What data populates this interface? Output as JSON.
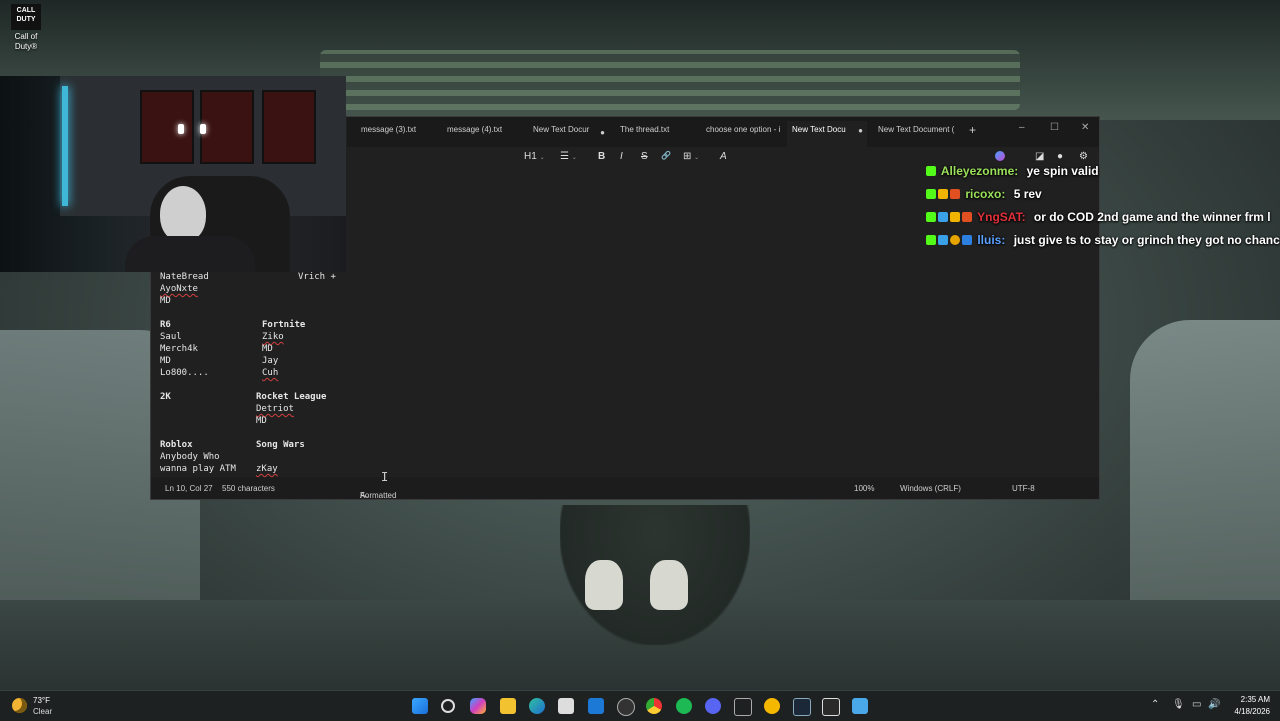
{
  "desktop": {
    "icon": {
      "badge_text": "CALL\nDUTY",
      "label": "Call of Duty®"
    }
  },
  "notepad": {
    "tabs": [
      {
        "label": "message (3).txt",
        "modified": false
      },
      {
        "label": "message (4).txt",
        "modified": false
      },
      {
        "label": "New Text Docur",
        "modified": true
      },
      {
        "label": "The thread.txt",
        "modified": false
      },
      {
        "label": "choose one option - i",
        "modified": false
      },
      {
        "label": "New Text Docu",
        "modified": true,
        "active": true
      },
      {
        "label": "New Text Document (",
        "modified": false
      }
    ],
    "new_tab_symbol": "+",
    "window_controls": {
      "minimize": "–",
      "maximize": "☐",
      "close": "✕"
    },
    "toolbar": {
      "heading": "H1",
      "chevron": "⌄",
      "list": "☰",
      "bold": "B",
      "italic": "I",
      "strike": "S",
      "link": "🔗",
      "table": "⊞",
      "clear": "A"
    },
    "lines": [
      {
        "left": "NateBread",
        "right": "Vrich +"
      },
      {
        "left": "AyoNxte",
        "right": ""
      },
      {
        "left": "MD",
        "right": ""
      },
      {
        "left": "",
        "right": ""
      },
      {
        "left": "R6",
        "right": "Fortnite"
      },
      {
        "left": "Saul",
        "right": "Ziko"
      },
      {
        "left": "Merch4k",
        "right": "MD"
      },
      {
        "left": "MD",
        "right": "Jay"
      },
      {
        "left": "Lo800....",
        "right": "Cuh"
      },
      {
        "left": "",
        "right": ""
      },
      {
        "left": "2K",
        "right": "Rocket League"
      },
      {
        "left": "",
        "right": "Detriot"
      },
      {
        "left": "",
        "right": "MD"
      },
      {
        "left": "",
        "right": ""
      },
      {
        "left": "Roblox",
        "right": "Song Wars"
      },
      {
        "left": "Anybody Who",
        "right": ""
      },
      {
        "left": "wanna play ATM",
        "right": "zKay"
      }
    ],
    "status": {
      "position": "Ln 10, Col 27",
      "characters": "550 characters",
      "mode": "Formatted",
      "zoom": "100%",
      "line_endings": "Windows (CRLF)",
      "encoding": "UTF-8"
    }
  },
  "chat": [
    {
      "user": "Alleyezonme:",
      "text": "ye spin valid",
      "user_color": "#9be05a"
    },
    {
      "user": "ricoxo:",
      "text": "5 rev",
      "user_color": "#9be05a"
    },
    {
      "user": "YngSAT:",
      "text": "or do COD 2nd game and the winner frm l",
      "user_color": "#e0303a"
    },
    {
      "user": "lluis:",
      "text": "just give ts to stay or grinch they got no chanc",
      "user_color": "#5aa0ff"
    }
  ],
  "taskbar": {
    "weather_temp": "73°F",
    "weather_cond": "Clear",
    "time": "2:35 AM",
    "date": "4/18/2026"
  }
}
